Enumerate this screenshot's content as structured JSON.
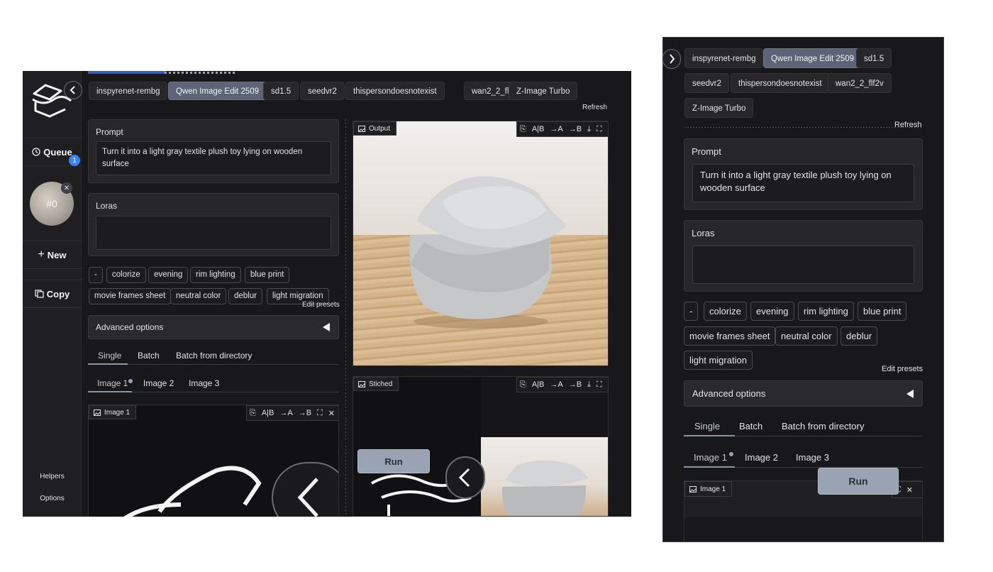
{
  "sidebar": {
    "queue_label": "Queue",
    "queue_badge": "1",
    "orb_label": "#0",
    "new_label": "New",
    "copy_label": "Copy",
    "helpers_label": "Helpers",
    "options_label": "Options"
  },
  "model_tabs": [
    "inspyrenet-rembg",
    "Qwen Image Edit 2509",
    "sd1.5",
    "seedvr2",
    "thispersondoesnotexist",
    "wan2_2_flf2v",
    "Z-Image Turbo"
  ],
  "active_model_tab": "Qwen Image Edit 2509",
  "refresh_label": "Refresh",
  "prompt": {
    "label": "Prompt",
    "value": "Turn it into a light gray textile plush toy lying on wooden surface"
  },
  "loras": {
    "label": "Loras",
    "value": ""
  },
  "presets": [
    "-",
    "colorize",
    "evening",
    "rim lighting",
    "blue print",
    "movie frames sheet",
    "neutral color",
    "deblur",
    "light migration"
  ],
  "edit_presets_label": "Edit presets",
  "advanced_options_label": "Advanced options",
  "mode_tabs": [
    "Single",
    "Batch",
    "Batch from directory"
  ],
  "image_tabs": [
    "Image 1",
    "Image 2",
    "Image 3"
  ],
  "image1_tag": "Image 1",
  "output_tag": "Output",
  "stiched_tag": "Stiched",
  "toolbar": {
    "ab": "A|B",
    "to_a": "→A",
    "to_b": "→B"
  },
  "run_label": "Run",
  "colors": {
    "accent": "#9aa3b4",
    "active_tab": "#5b6577",
    "badge": "#3b82f6",
    "bg": "#18181b"
  }
}
